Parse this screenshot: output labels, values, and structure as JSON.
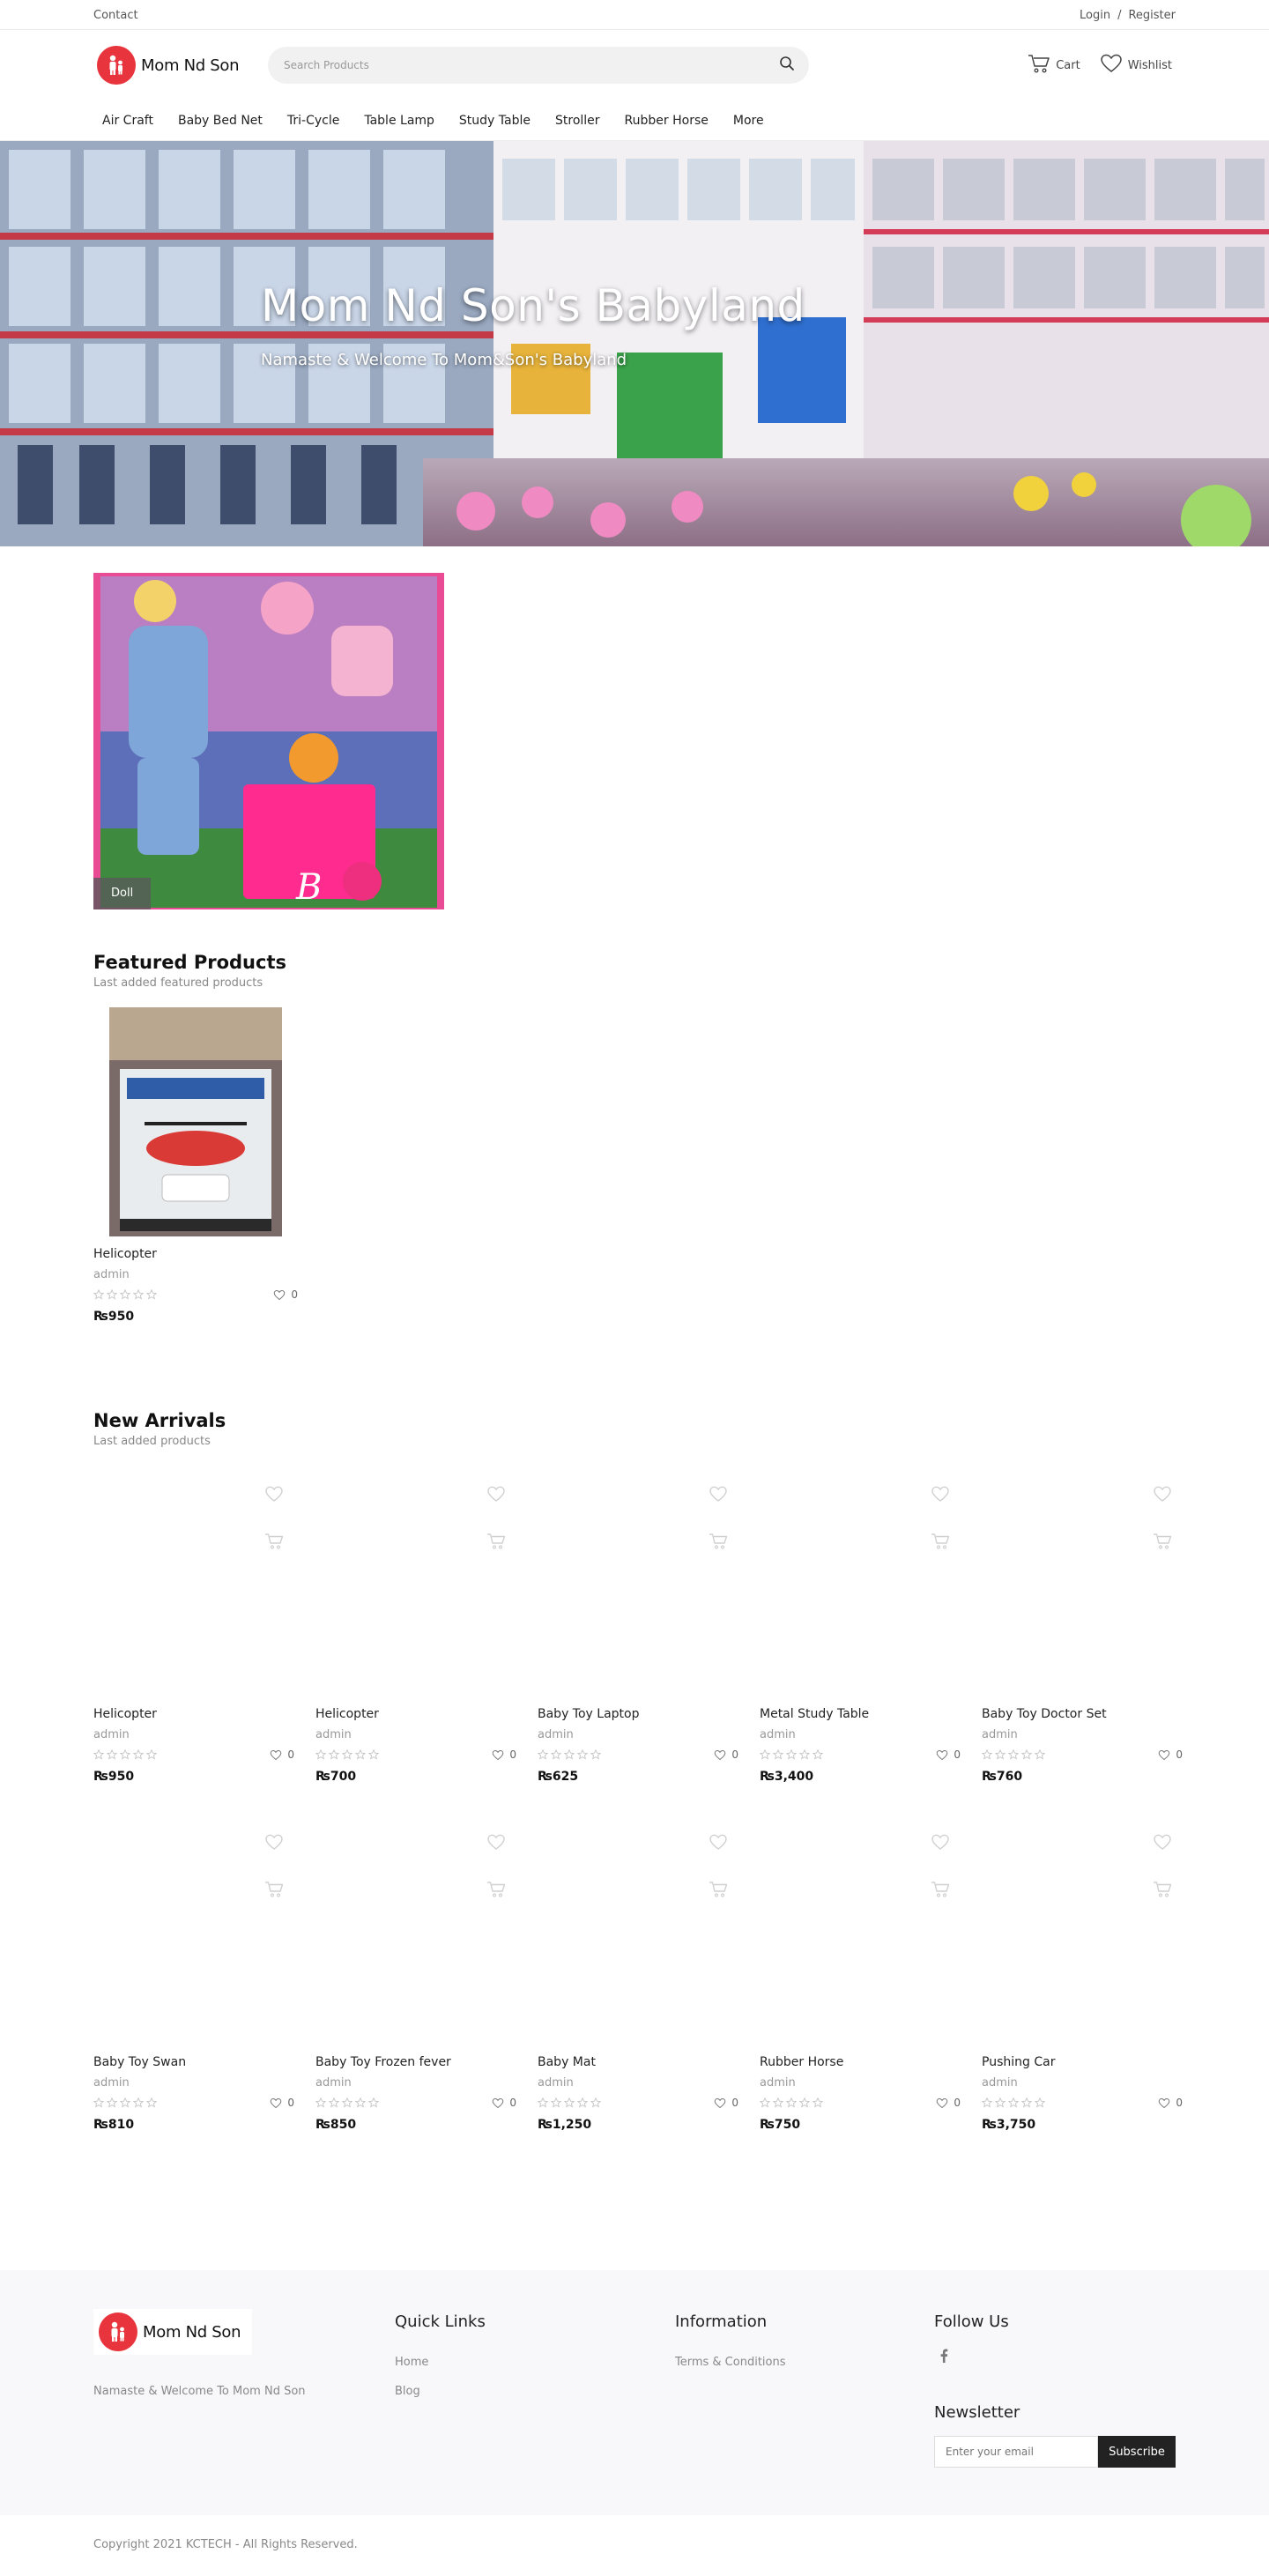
{
  "topbar": {
    "contact": "Contact",
    "login": "Login",
    "separator": "/",
    "register": "Register"
  },
  "header": {
    "logo_text": "Mom Nd Son",
    "search_placeholder": "Search Products",
    "cart_label": "Cart",
    "wishlist_label": "Wishlist"
  },
  "nav": {
    "items": [
      "Air Craft",
      "Baby Bed Net",
      "Tri-Cycle",
      "Table Lamp",
      "Study Table",
      "Stroller",
      "Rubber Horse",
      "More"
    ]
  },
  "hero": {
    "title": "Mom Nd Son's Babyland",
    "subtitle": "Namaste & Welcome To Mom&Son's Babyland"
  },
  "category": {
    "label": "Doll"
  },
  "featured": {
    "title": "Featured Products",
    "subtitle": "Last added featured products",
    "product": {
      "name": "Helicopter",
      "author": "admin",
      "wishlist_count": "0",
      "price": "₨950",
      "rating": 0
    }
  },
  "arrivals": {
    "title": "New Arrivals",
    "subtitle": "Last added products",
    "products": [
      {
        "name": "Helicopter",
        "author": "admin",
        "wishlist_count": "0",
        "price": "₨950"
      },
      {
        "name": "Helicopter",
        "author": "admin",
        "wishlist_count": "0",
        "price": "₨700"
      },
      {
        "name": "Baby Toy Laptop",
        "author": "admin",
        "wishlist_count": "0",
        "price": "₨625"
      },
      {
        "name": "Metal Study Table",
        "author": "admin",
        "wishlist_count": "0",
        "price": "₨3,400"
      },
      {
        "name": "Baby Toy Doctor Set",
        "author": "admin",
        "wishlist_count": "0",
        "price": "₨760"
      },
      {
        "name": "Baby Toy Swan",
        "author": "admin",
        "wishlist_count": "0",
        "price": "₨810"
      },
      {
        "name": "Baby Toy Frozen fever",
        "author": "admin",
        "wishlist_count": "0",
        "price": "₨850"
      },
      {
        "name": "Baby Mat",
        "author": "admin",
        "wishlist_count": "0",
        "price": "₨1,250"
      },
      {
        "name": "Rubber Horse",
        "author": "admin",
        "wishlist_count": "0",
        "price": "₨750"
      },
      {
        "name": "Pushing Car",
        "author": "admin",
        "wishlist_count": "0",
        "price": "₨3,750"
      }
    ]
  },
  "footer": {
    "logo_text": "Mom Nd Son",
    "about": "Namaste & Welcome To Mom Nd Son",
    "quick_links_title": "Quick Links",
    "quick_links": [
      "Home",
      "Blog"
    ],
    "information_title": "Information",
    "information_links": [
      "Terms & Conditions"
    ],
    "follow_title": "Follow Us",
    "newsletter_title": "Newsletter",
    "newsletter_placeholder": "Enter your email",
    "subscribe_label": "Subscribe",
    "copyright": "Copyright 2021 KCTECH - All Rights Reserved."
  },
  "colors": {
    "brand_red": "#e8343c",
    "dark": "#222222",
    "muted": "#888888"
  }
}
